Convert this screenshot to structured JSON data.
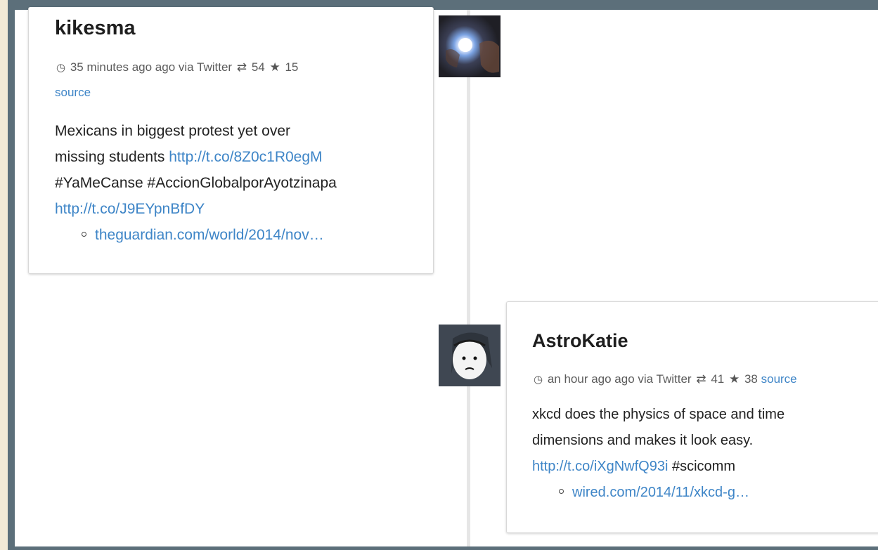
{
  "tweets": [
    {
      "author": "kikesma",
      "time": "35 minutes ago ago via Twitter",
      "retweets": "54",
      "favorites": "15",
      "source_label": "source",
      "text_lines": [
        "Mexicans in biggest protest yet over",
        "missing students",
        "#YaMeCanse #AccionGlobalporAyotzinapa"
      ],
      "link1": "http://t.co/8Z0c1R0egM",
      "link2": "http://t.co/J9EYpnBfDY",
      "preview_link": "theguardian.com/world/2014/nov…",
      "icons": {
        "clock": "clock-icon",
        "retweet": "retweet-icon",
        "favorite": "star-icon"
      }
    },
    {
      "author": "AstroKatie",
      "time": "an hour ago ago via Twitter",
      "retweets": "41",
      "favorites": "38",
      "source_label": "source",
      "text_lines": [
        "xkcd does the physics of space and time",
        "dimensions and makes it look easy.",
        "#scicomm"
      ],
      "link1": "http://t.co/iXgNwfQ93i",
      "preview_link": "wired.com/2014/11/xkcd-g…",
      "icons": {
        "clock": "clock-icon",
        "retweet": "retweet-icon",
        "favorite": "star-icon"
      }
    }
  ],
  "colors": {
    "link": "#3e85c7",
    "frame": "#5c6f7a",
    "timeline": "#e6e6e6"
  }
}
